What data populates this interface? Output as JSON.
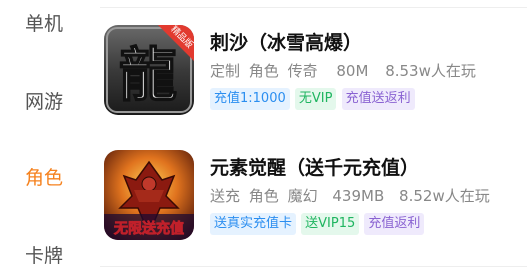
{
  "sidebar": {
    "items": [
      {
        "label": "单机",
        "active": false
      },
      {
        "label": "网游",
        "active": false
      },
      {
        "label": "角色",
        "active": true
      },
      {
        "label": "卡牌",
        "active": false
      }
    ],
    "active_color": "#f5821f"
  },
  "games": [
    {
      "title": "刺沙（冰雪高爆）",
      "icon_glyph": "龍",
      "icon_badge": "精品版",
      "meta": [
        "定制",
        "角色",
        "传奇",
        "80M",
        "8.53w人在玩"
      ],
      "tags": [
        {
          "label": "充值1:1000",
          "color": "blue"
        },
        {
          "label": "无VIP",
          "color": "green"
        },
        {
          "label": "充值送返利",
          "color": "purple"
        }
      ]
    },
    {
      "title": "元素觉醒（送千元充值）",
      "icon_banner": "无限送充值",
      "meta": [
        "送充",
        "角色",
        "魔幻",
        "439MB",
        "8.52w人在玩"
      ],
      "tags": [
        {
          "label": "送真实充值卡",
          "color": "blue"
        },
        {
          "label": "送VIP15",
          "color": "green"
        },
        {
          "label": "充值返利",
          "color": "purple"
        }
      ]
    }
  ],
  "colors": {
    "tag_blue": "#2b8ef0",
    "tag_green": "#1fb560",
    "tag_purple": "#8a63d2"
  }
}
